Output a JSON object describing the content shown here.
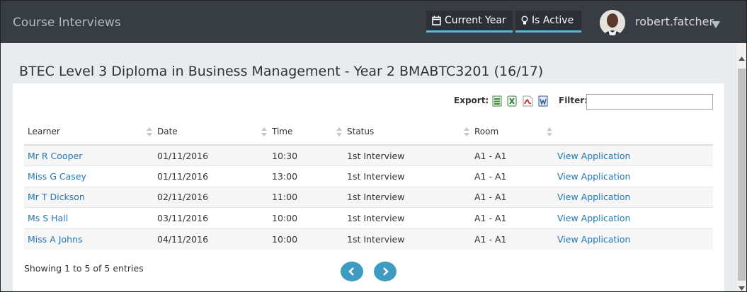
{
  "header": {
    "app_title": "Course Interviews",
    "current_year_label": "Current Year",
    "is_active_label": "Is Active",
    "username": "robert.fatcher",
    "accent_color": "#5bb8dd"
  },
  "page": {
    "title": "BTEC Level 3 Diploma in Business Management - Year 2 BMABTC3201 (16/17)"
  },
  "toolbar": {
    "export_label": "Export:",
    "export_icons": [
      "csv-icon",
      "excel-icon",
      "pdf-icon",
      "word-icon"
    ],
    "filter_label": "Filter:",
    "filter_value": ""
  },
  "table": {
    "columns": [
      "Learner",
      "Date",
      "Time",
      "Status",
      "Room"
    ],
    "rows": [
      {
        "learner": "Mr R Cooper",
        "date": "01/11/2016",
        "time": "10:30",
        "status": "1st Interview",
        "room": "A1 - A1",
        "action": "View Application"
      },
      {
        "learner": "Miss G Casey",
        "date": "01/11/2016",
        "time": "13:00",
        "status": "1st Interview",
        "room": "A1 - A1",
        "action": "View Application"
      },
      {
        "learner": "Mr T Dickson",
        "date": "02/11/2016",
        "time": "11:00",
        "status": "1st Interview",
        "room": "A1 - A1",
        "action": "View Application"
      },
      {
        "learner": "Ms S Hall",
        "date": "03/11/2016",
        "time": "10:00",
        "status": "1st Interview",
        "room": "A1 - A1",
        "action": "View Application"
      },
      {
        "learner": "Miss A Johns",
        "date": "04/11/2016",
        "time": "10:00",
        "status": "1st Interview",
        "room": "A1 - A1",
        "action": "View Application"
      }
    ]
  },
  "footer": {
    "info": "Showing 1 to 5 of 5 entries"
  }
}
